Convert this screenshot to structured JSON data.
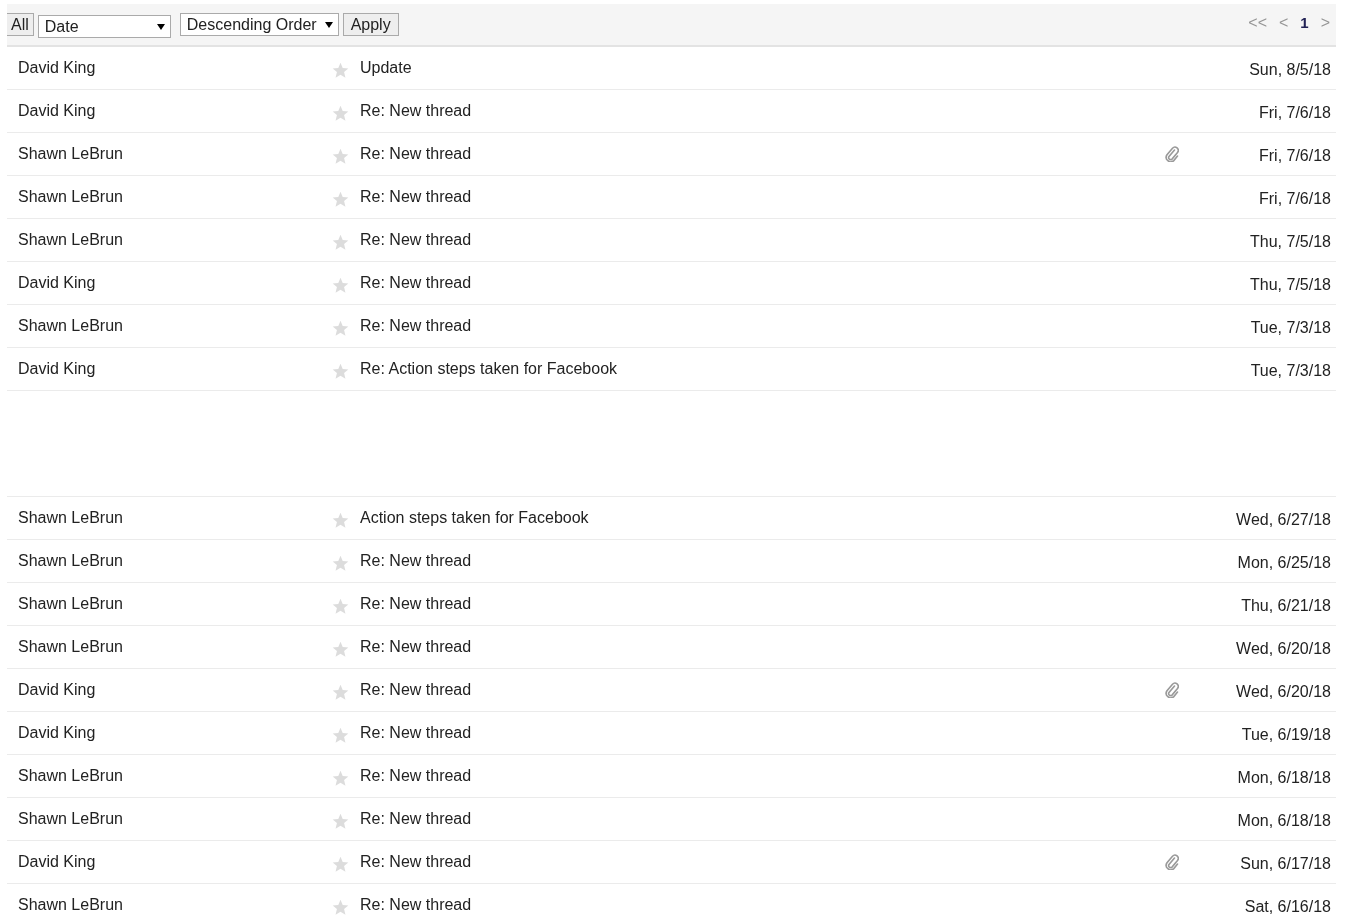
{
  "toolbar": {
    "select_all": "All",
    "sort_field": "Date",
    "sort_order": "Descending Order",
    "apply": "Apply"
  },
  "pagination": {
    "first": "<<",
    "prev": "<",
    "page": "1",
    "next": ">"
  },
  "groups": [
    {
      "emails": [
        {
          "sender": "David King",
          "starred": false,
          "subject": "Update",
          "attachment": false,
          "date": "Sun, 8/5/18"
        },
        {
          "sender": "David King",
          "starred": false,
          "subject": "Re: New thread",
          "attachment": false,
          "date": "Fri, 7/6/18"
        },
        {
          "sender": "Shawn LeBrun",
          "starred": false,
          "subject": "Re: New thread",
          "attachment": true,
          "date": "Fri, 7/6/18"
        },
        {
          "sender": "Shawn LeBrun",
          "starred": false,
          "subject": "Re: New thread",
          "attachment": false,
          "date": "Fri, 7/6/18"
        },
        {
          "sender": "Shawn LeBrun",
          "starred": false,
          "subject": "Re: New thread",
          "attachment": false,
          "date": "Thu, 7/5/18"
        },
        {
          "sender": "David King",
          "starred": false,
          "subject": "Re: New thread",
          "attachment": false,
          "date": "Thu, 7/5/18"
        },
        {
          "sender": "Shawn LeBrun",
          "starred": false,
          "subject": "Re: New thread",
          "attachment": false,
          "date": "Tue, 7/3/18"
        },
        {
          "sender": "David King",
          "starred": false,
          "subject": "Re: Action steps taken for Facebook",
          "attachment": false,
          "date": "Tue, 7/3/18"
        }
      ]
    },
    {
      "emails": [
        {
          "sender": "Shawn LeBrun",
          "starred": false,
          "subject": "Action steps taken for Facebook",
          "attachment": false,
          "date": "Wed, 6/27/18"
        },
        {
          "sender": "Shawn LeBrun",
          "starred": false,
          "subject": "Re: New thread",
          "attachment": false,
          "date": "Mon, 6/25/18"
        },
        {
          "sender": "Shawn LeBrun",
          "starred": false,
          "subject": "Re: New thread",
          "attachment": false,
          "date": "Thu, 6/21/18"
        },
        {
          "sender": "Shawn LeBrun",
          "starred": false,
          "subject": "Re: New thread",
          "attachment": false,
          "date": "Wed, 6/20/18"
        },
        {
          "sender": "David King",
          "starred": false,
          "subject": "Re: New thread",
          "attachment": true,
          "date": "Wed, 6/20/18"
        },
        {
          "sender": "David King",
          "starred": false,
          "subject": "Re: New thread",
          "attachment": false,
          "date": "Tue, 6/19/18"
        },
        {
          "sender": "Shawn LeBrun",
          "starred": false,
          "subject": "Re: New thread",
          "attachment": false,
          "date": "Mon, 6/18/18"
        },
        {
          "sender": "Shawn LeBrun",
          "starred": false,
          "subject": "Re: New thread",
          "attachment": false,
          "date": "Mon, 6/18/18"
        },
        {
          "sender": "David King",
          "starred": false,
          "subject": "Re: New thread",
          "attachment": true,
          "date": "Sun, 6/17/18"
        },
        {
          "sender": "Shawn LeBrun",
          "starred": false,
          "subject": "Re: New thread",
          "attachment": false,
          "date": "Sat, 6/16/18"
        }
      ]
    }
  ]
}
